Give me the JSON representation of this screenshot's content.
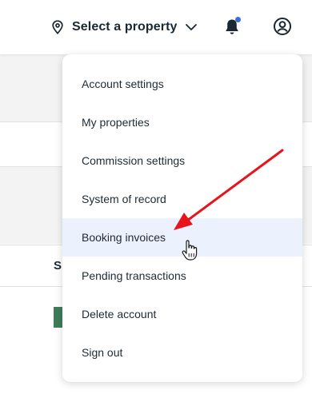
{
  "header": {
    "property_selector_label": "Select a property",
    "icons": {
      "location": "map-pin-icon",
      "dropdown": "chevron-down-icon",
      "notifications": "bell-icon",
      "account": "user-circle-icon"
    },
    "notification_dot_color": "#3b6fd8"
  },
  "background": {
    "column_header_fragment": "S"
  },
  "menu": {
    "items": [
      {
        "label": "Account settings"
      },
      {
        "label": "My properties"
      },
      {
        "label": "Commission settings"
      },
      {
        "label": "System of record"
      },
      {
        "label": "Booking invoices",
        "highlighted": true
      },
      {
        "label": "Pending transactions"
      },
      {
        "label": "Delete account"
      },
      {
        "label": "Sign out"
      }
    ],
    "highlight_color": "#ebf2fd"
  },
  "annotation": {
    "arrow_color": "#e8141c",
    "cursor": "hand-pointer-icon"
  }
}
